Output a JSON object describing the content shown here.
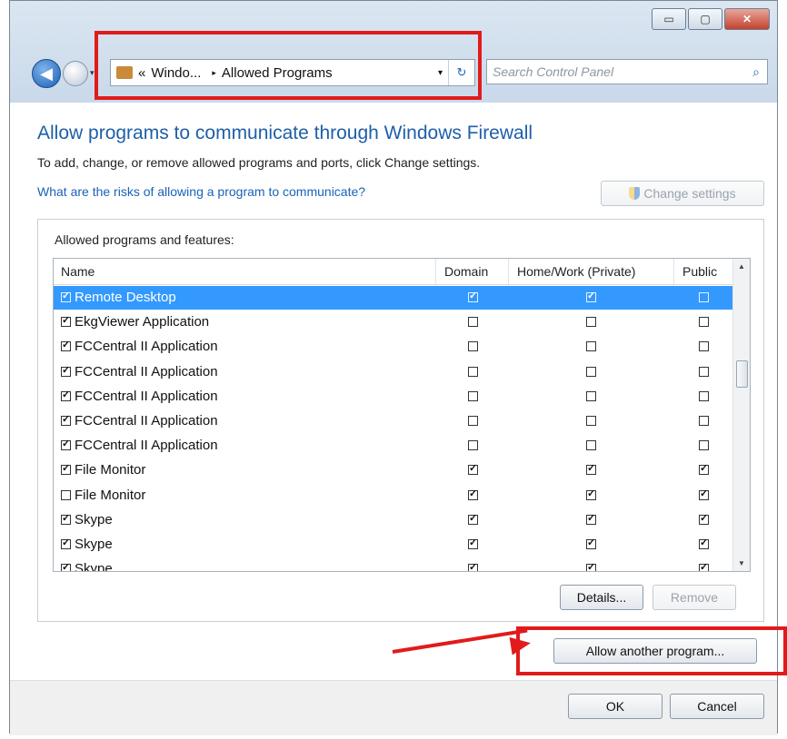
{
  "window": {
    "controls": {
      "minimize": "▭",
      "maximize": "▢",
      "close": "✕"
    }
  },
  "nav": {
    "back_glyph": "◀",
    "dropdown_glyph": "▾",
    "address": {
      "overflow": "«",
      "crumb1": "Windo...",
      "separator": "▸",
      "crumb2": "Allowed Programs",
      "caret": "▾",
      "refresh_glyph": "↻"
    },
    "search": {
      "placeholder": "Search Control Panel",
      "icon_glyph": "⌕"
    }
  },
  "page": {
    "heading": "Allow programs to communicate through Windows Firewall",
    "subtext": "To add, change, or remove allowed programs and ports, click Change settings.",
    "risk_link": "What are the risks of allowing a program to communicate?",
    "change_settings": "Change settings"
  },
  "list": {
    "group_label": "Allowed programs and features:",
    "columns": {
      "name": "Name",
      "domain": "Domain",
      "home": "Home/Work (Private)",
      "public": "Public"
    },
    "rows": [
      {
        "name": "Remote Desktop",
        "enabled": true,
        "domain": true,
        "home": true,
        "public": false,
        "selected": true
      },
      {
        "name": "EkgViewer Application",
        "enabled": true,
        "domain": false,
        "home": false,
        "public": false
      },
      {
        "name": "FCCentral II Application",
        "enabled": true,
        "domain": false,
        "home": false,
        "public": false
      },
      {
        "name": "FCCentral II Application",
        "enabled": true,
        "domain": false,
        "home": false,
        "public": false
      },
      {
        "name": "FCCentral II Application",
        "enabled": true,
        "domain": false,
        "home": false,
        "public": false
      },
      {
        "name": "FCCentral II Application",
        "enabled": true,
        "domain": false,
        "home": false,
        "public": false
      },
      {
        "name": "FCCentral II Application",
        "enabled": true,
        "domain": false,
        "home": false,
        "public": false
      },
      {
        "name": "File Monitor",
        "enabled": true,
        "domain": true,
        "home": true,
        "public": true
      },
      {
        "name": "File Monitor",
        "enabled": false,
        "domain": true,
        "home": true,
        "public": true
      },
      {
        "name": "Skype",
        "enabled": true,
        "domain": true,
        "home": true,
        "public": true
      },
      {
        "name": "Skype",
        "enabled": true,
        "domain": true,
        "home": true,
        "public": true
      },
      {
        "name": "Skype",
        "enabled": true,
        "domain": true,
        "home": true,
        "public": true
      }
    ],
    "scroll_up": "▲",
    "scroll_down": "▼"
  },
  "buttons": {
    "details": "Details...",
    "remove": "Remove",
    "allow_another": "Allow another program...",
    "ok": "OK",
    "cancel": "Cancel"
  },
  "colors": {
    "highlight": "#e11b1b",
    "selection": "#3399ff",
    "heading": "#1d5fa8",
    "link": "#1a62b8"
  }
}
